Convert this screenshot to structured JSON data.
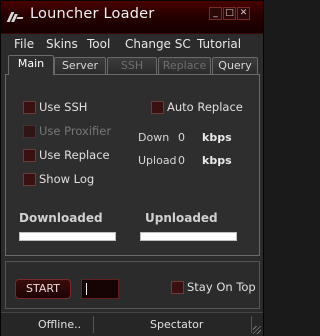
{
  "window": {
    "title": "Louncher Loader",
    "controls": [
      "_",
      "□",
      "✕"
    ]
  },
  "menu": {
    "items": [
      "File",
      "Skins",
      "Tool",
      "Change SC",
      "Tutorial"
    ]
  },
  "tabs": [
    {
      "label": "Main",
      "state": "active"
    },
    {
      "label": "Server",
      "state": "normal"
    },
    {
      "label": "SSH",
      "state": "disabled"
    },
    {
      "label": "Replace",
      "state": "disabled"
    },
    {
      "label": "Query",
      "state": "normal"
    }
  ],
  "options": {
    "use_ssh": "Use SSH",
    "use_proxifier": "Use Proxifier",
    "use_replace": "Use Replace",
    "show_log": "Show Log",
    "auto_replace": "Auto Replace"
  },
  "stats": {
    "down_label": "Down",
    "down_value": "0",
    "upload_label": "Upload",
    "upload_value": "0",
    "unit": "kbps"
  },
  "progress": {
    "downloaded_label": "Downloaded",
    "downloaded_fraction": 0,
    "uploaded_label": "Upnloaded",
    "uploaded_fraction": 0
  },
  "controls": {
    "start_label": "START",
    "input_value": "",
    "stay_on_top": "Stay On Top"
  },
  "status": {
    "connection": "Offline..",
    "mode": "Spectator"
  },
  "colors": {
    "accent": "#4a0000",
    "checkbox": "#3a1010"
  }
}
